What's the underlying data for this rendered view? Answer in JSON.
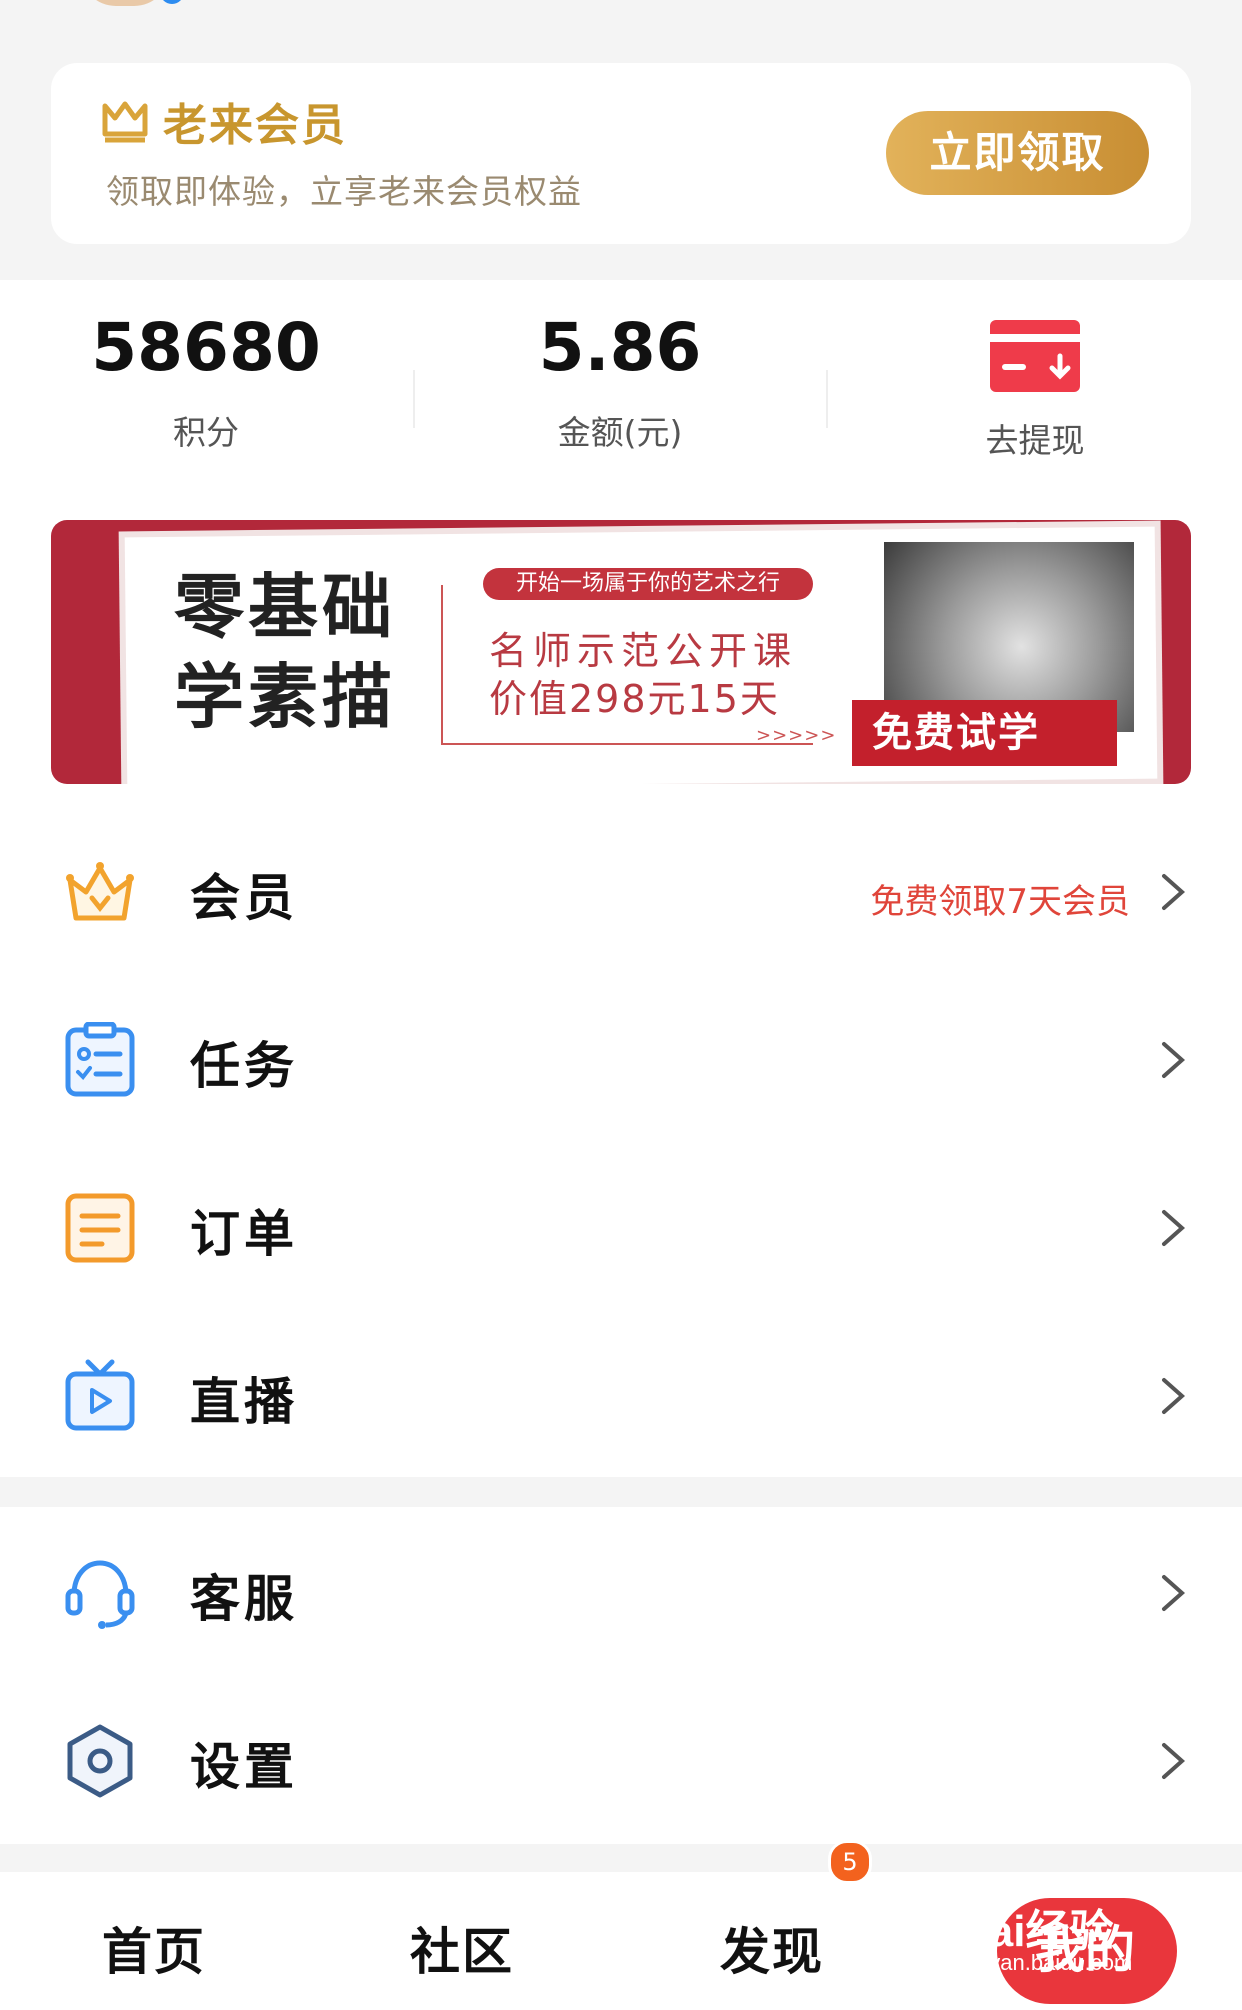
{
  "vip": {
    "title": "老来会员",
    "subtitle": "领取即体验，立享老来会员权益",
    "button": "立即领取"
  },
  "stats": {
    "points": {
      "value": "58680",
      "label": "积分"
    },
    "amount": {
      "value": "5.86",
      "label": "金额(元)"
    },
    "withdraw": {
      "label": "去提现"
    }
  },
  "banner": {
    "title_line1": "零基础",
    "title_line2": "学素描",
    "tag": "开始一场属于你的艺术之行",
    "line1": "名师示范公开课",
    "line2": "价值298元15天",
    "arrows": ">>>>>",
    "cta": "免费试学"
  },
  "menu": [
    {
      "label": "会员",
      "extra": "免费领取7天会员",
      "icon": "crown-icon"
    },
    {
      "label": "任务",
      "extra": "",
      "icon": "task-clipboard-icon"
    },
    {
      "label": "订单",
      "extra": "",
      "icon": "order-list-icon"
    },
    {
      "label": "直播",
      "extra": "",
      "icon": "live-tv-icon"
    }
  ],
  "menu2": [
    {
      "label": "客服",
      "icon": "headset-icon"
    },
    {
      "label": "设置",
      "icon": "settings-hexagon-icon"
    }
  ],
  "tabs": {
    "home": "首页",
    "community": "社区",
    "discover": "发现",
    "discover_badge": "5",
    "mine": "我的"
  },
  "watermark": {
    "text": "Bai经验",
    "url": "jingyan.baidu.com"
  },
  "colors": {
    "gold": "#c8962e",
    "red": "#e9363c",
    "blue": "#3a8ff0",
    "orange": "#f39a2b"
  }
}
